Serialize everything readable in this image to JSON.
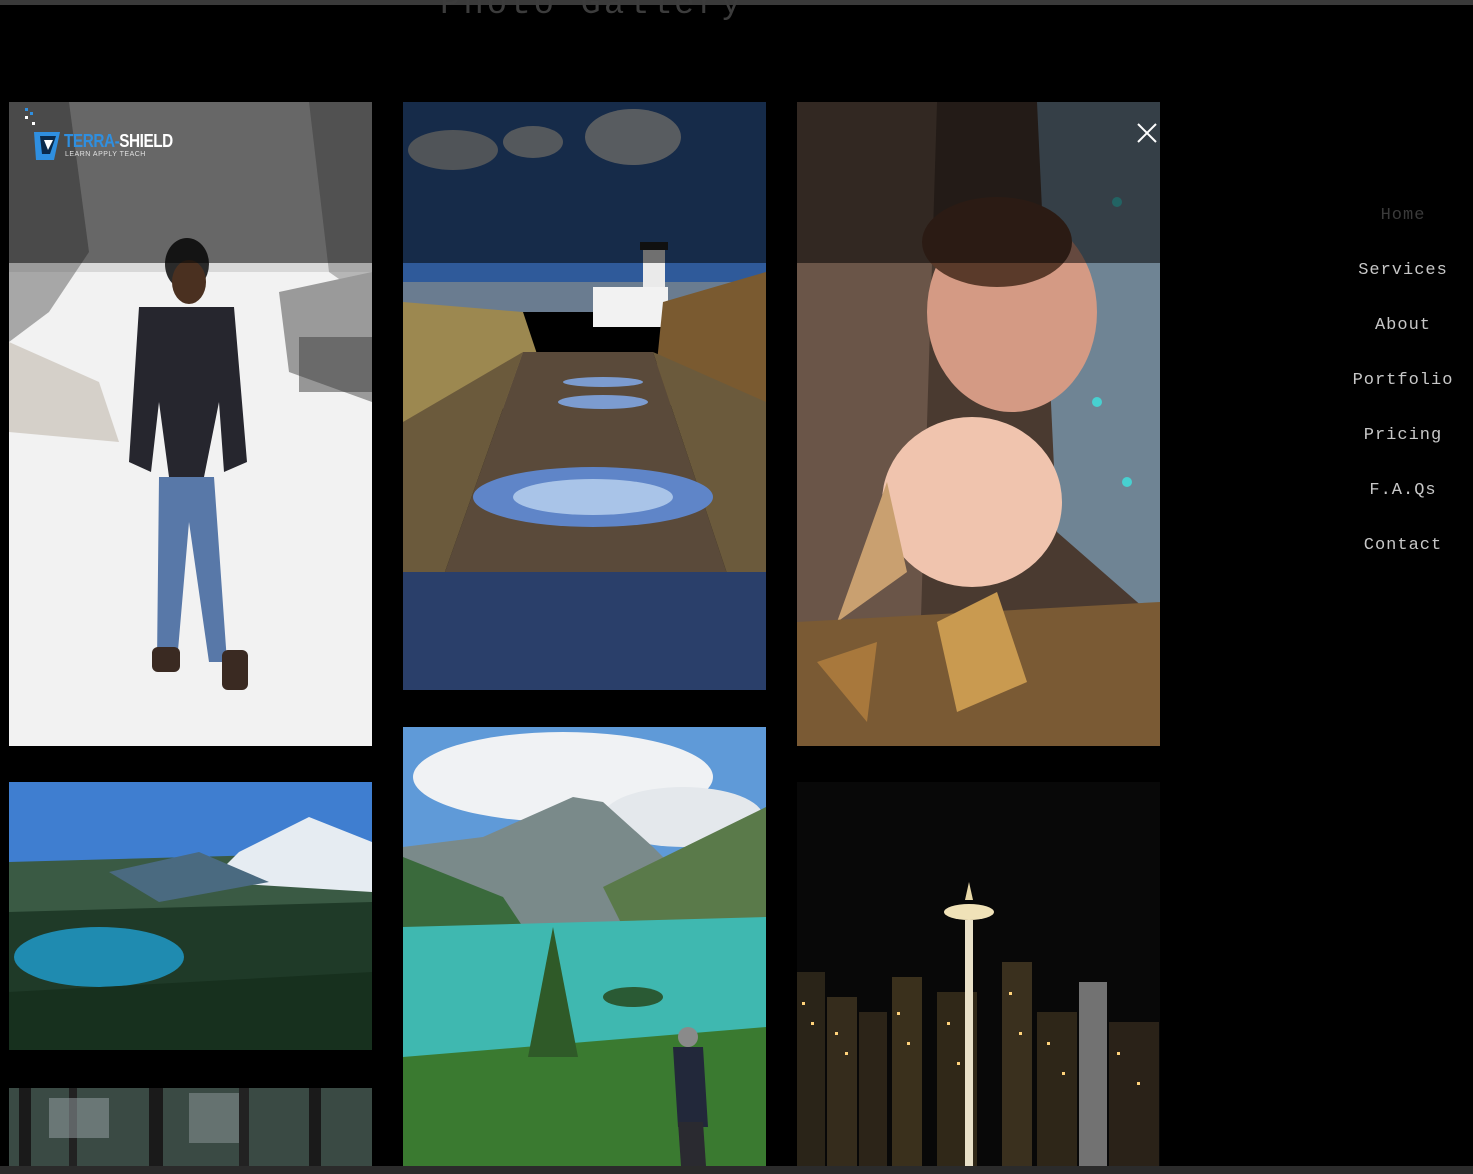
{
  "page": {
    "title": "Photo Gallery"
  },
  "logo": {
    "name_part1": "TERRA-",
    "name_part2": "SHIELD",
    "tagline": "LEARN APPLY TEACH"
  },
  "close": {
    "label": "close-icon"
  },
  "nav": {
    "items": [
      {
        "label": "Home",
        "active": true
      },
      {
        "label": "Services"
      },
      {
        "label": "About"
      },
      {
        "label": "Portfolio"
      },
      {
        "label": "Pricing"
      },
      {
        "label": "F.A.Qs"
      },
      {
        "label": "Contact"
      }
    ]
  },
  "gallery": {
    "photos": [
      {
        "name": "photo-man-in-snow"
      },
      {
        "name": "photo-lighthouse-puddles"
      },
      {
        "name": "photo-couple-in-leaves"
      },
      {
        "name": "photo-mountain-lake"
      },
      {
        "name": "photo-diablo-lake-hiker"
      },
      {
        "name": "photo-seattle-space-needle"
      },
      {
        "name": "photo-forest-trees"
      }
    ]
  },
  "colors": {
    "background": "#000000",
    "nav_text": "#c7c7c7",
    "logo_accent": "#2f8fe0"
  }
}
